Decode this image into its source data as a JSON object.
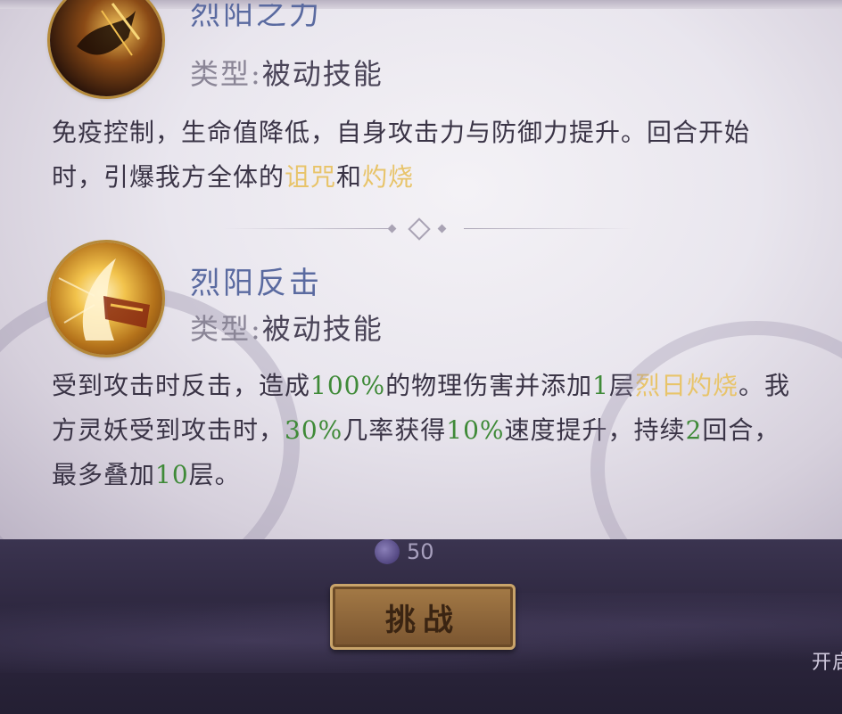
{
  "skills": [
    {
      "name": "烈阳之力",
      "type_key": "类型:",
      "type_value": "被动技能",
      "desc": {
        "t1": "免疫控制，生命值降低，自身攻击力与防御力提升。回合开始时，引爆我方全体的",
        "h1": "诅咒",
        "t2": "和",
        "h2": "灼烧"
      },
      "icon": "sun-power-icon"
    },
    {
      "name": "烈阳反击",
      "type_key": "类型:",
      "type_value": "被动技能",
      "desc": {
        "t1": "受到攻击时反击，造成",
        "n1": "100%",
        "t2": "的物理伤害并添加",
        "n2": "1",
        "t3": "层",
        "h1": "烈日灼烧",
        "t4": "。我方灵妖受到攻击时，",
        "n3": "30%",
        "t5": "几率获得",
        "n4": "10%",
        "t6": "速度提升，持续",
        "n5": "2",
        "t7": "回合，最多叠加",
        "n6": "10",
        "t8": "层。"
      },
      "icon": "sun-counter-icon"
    }
  ],
  "cost": {
    "value": "50",
    "icon": "spirit-orb-icon"
  },
  "buttons": {
    "challenge": "挑战"
  },
  "side_hint": "开启",
  "colors": {
    "highlight_gold": "#e8c46a",
    "highlight_green": "#3f8a38",
    "skill_name": "#5a6aa0"
  }
}
